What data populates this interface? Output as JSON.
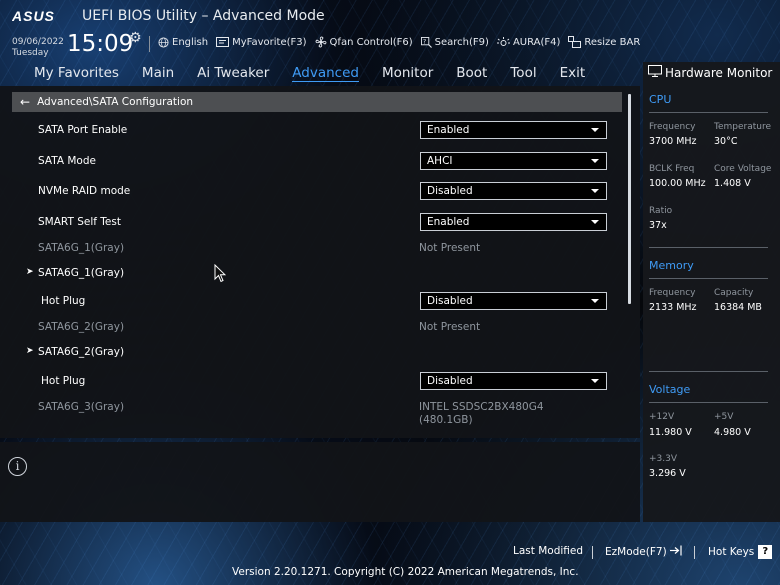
{
  "header": {
    "logo_text": "ASUS",
    "title": "UEFI BIOS Utility – Advanced Mode",
    "date": "09/06/2022",
    "weekday": "Tuesday",
    "time": "15:09",
    "toolbar": [
      {
        "icon": "globe-icon",
        "label": "English"
      },
      {
        "icon": "favorite-icon",
        "label": "MyFavorite(F3)"
      },
      {
        "icon": "fan-icon",
        "label": "Qfan Control(F6)"
      },
      {
        "icon": "search-icon",
        "label": "Search(F9)"
      },
      {
        "icon": "aura-icon",
        "label": "AURA(F4)"
      },
      {
        "icon": "resize-bar-icon",
        "label": "Resize BAR"
      }
    ]
  },
  "tabs": [
    {
      "label": "My Favorites",
      "active": false
    },
    {
      "label": "Main",
      "active": false
    },
    {
      "label": "Ai Tweaker",
      "active": false
    },
    {
      "label": "Advanced",
      "active": true
    },
    {
      "label": "Monitor",
      "active": false
    },
    {
      "label": "Boot",
      "active": false
    },
    {
      "label": "Tool",
      "active": false
    },
    {
      "label": "Exit",
      "active": false
    }
  ],
  "breadcrumb": "Advanced\\SATA Configuration",
  "settings": [
    {
      "label": "SATA Port Enable",
      "value": "Enabled"
    },
    {
      "label": "SATA Mode",
      "value": "AHCI"
    },
    {
      "label": "NVMe RAID mode",
      "value": "Disabled"
    },
    {
      "label": "SMART Self Test",
      "value": "Enabled"
    },
    {
      "label": "SATA6G_1(Gray)",
      "value": "Not Present"
    },
    {
      "label": "SATA6G_1(Gray)"
    },
    {
      "label": "Hot Plug",
      "value": "Disabled"
    },
    {
      "label": "SATA6G_2(Gray)",
      "value": "Not Present"
    },
    {
      "label": "SATA6G_2(Gray)"
    },
    {
      "label": "Hot Plug",
      "value": "Disabled"
    },
    {
      "label": "SATA6G_3(Gray)",
      "value_line1": "INTEL SSDSC2BX480G4",
      "value_line2": "(480.1GB)"
    }
  ],
  "hardware_monitor": {
    "title": "Hardware Monitor",
    "cpu": {
      "heading": "CPU",
      "frequency_label": "Frequency",
      "frequency": "3700 MHz",
      "temperature_label": "Temperature",
      "temperature": "30°C",
      "bclk_label": "BCLK Freq",
      "bclk": "100.00 MHz",
      "core_voltage_label": "Core Voltage",
      "core_voltage": "1.408 V",
      "ratio_label": "Ratio",
      "ratio": "37x"
    },
    "memory": {
      "heading": "Memory",
      "frequency_label": "Frequency",
      "frequency": "2133 MHz",
      "capacity_label": "Capacity",
      "capacity": "16384 MB"
    },
    "voltage": {
      "heading": "Voltage",
      "v12_label": "+12V",
      "v12": "11.980 V",
      "v5_label": "+5V",
      "v5": "4.980 V",
      "v33_label": "+3.3V",
      "v33": "3.296 V"
    }
  },
  "footer": {
    "last_modified": "Last Modified",
    "ezmode": "EzMode(F7)",
    "hot_keys": "Hot Keys",
    "hot_keys_badge": "?",
    "version": "Version 2.20.1271. Copyright (C) 2022 American Megatrends, Inc."
  },
  "colors": {
    "accent": "#3f9bf5",
    "panel": "#121418",
    "breadcrumb_bar": "#4d4f52"
  }
}
